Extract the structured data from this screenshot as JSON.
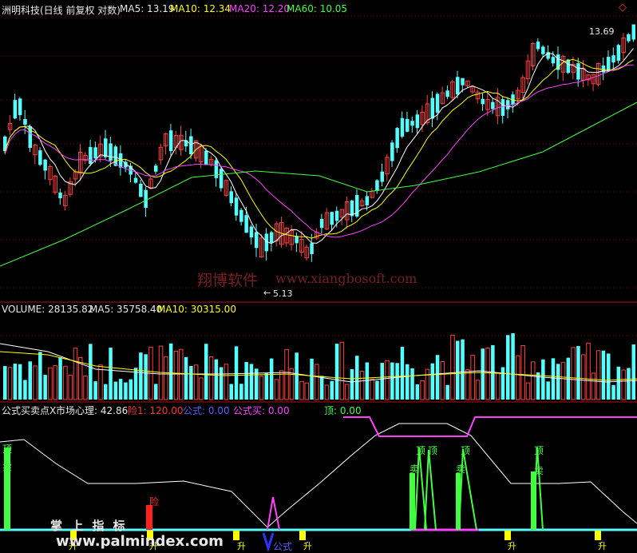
{
  "main_panel": {
    "stock": "洲明科技(日线 前复权 对数)",
    "ma5": "MA5: 13.19",
    "ma10": "MA10: 12.34",
    "ma20": "MA20: 12.20",
    "ma60": "MA60: 10.05",
    "high_label": "13.69",
    "low_label": "5.13",
    "watermark_cn": "翔博软件",
    "watermark_url": "www.xiangbosoft.com",
    "colors": {
      "up": "#ff4040",
      "down": "#54ffff",
      "ma5": "#ffffff",
      "ma10": "#ffff00",
      "ma20": "#ff40ff",
      "ma60": "#40ff40"
    }
  },
  "volume_panel": {
    "volume": "VOLUME: 28135.82",
    "ma5": "MA5: 35758.40",
    "ma10": "MA10: 30315.00"
  },
  "indicator_panel": {
    "name": "公式买卖点X",
    "market_mind": "市场心理: 42.86",
    "risk": "险1: 120.00",
    "formula1": "公式: 0.00",
    "formula_buy": "公式买: 0.00",
    "top": "顶: 0.00",
    "signal_top": "顶",
    "signal_sell": "卖",
    "signal_rise": "升",
    "signal_formula": "公式",
    "signal_risk": "险"
  },
  "footer_watermark": "www.palmindex.com",
  "footer_caption": "掌 上 指 标"
}
